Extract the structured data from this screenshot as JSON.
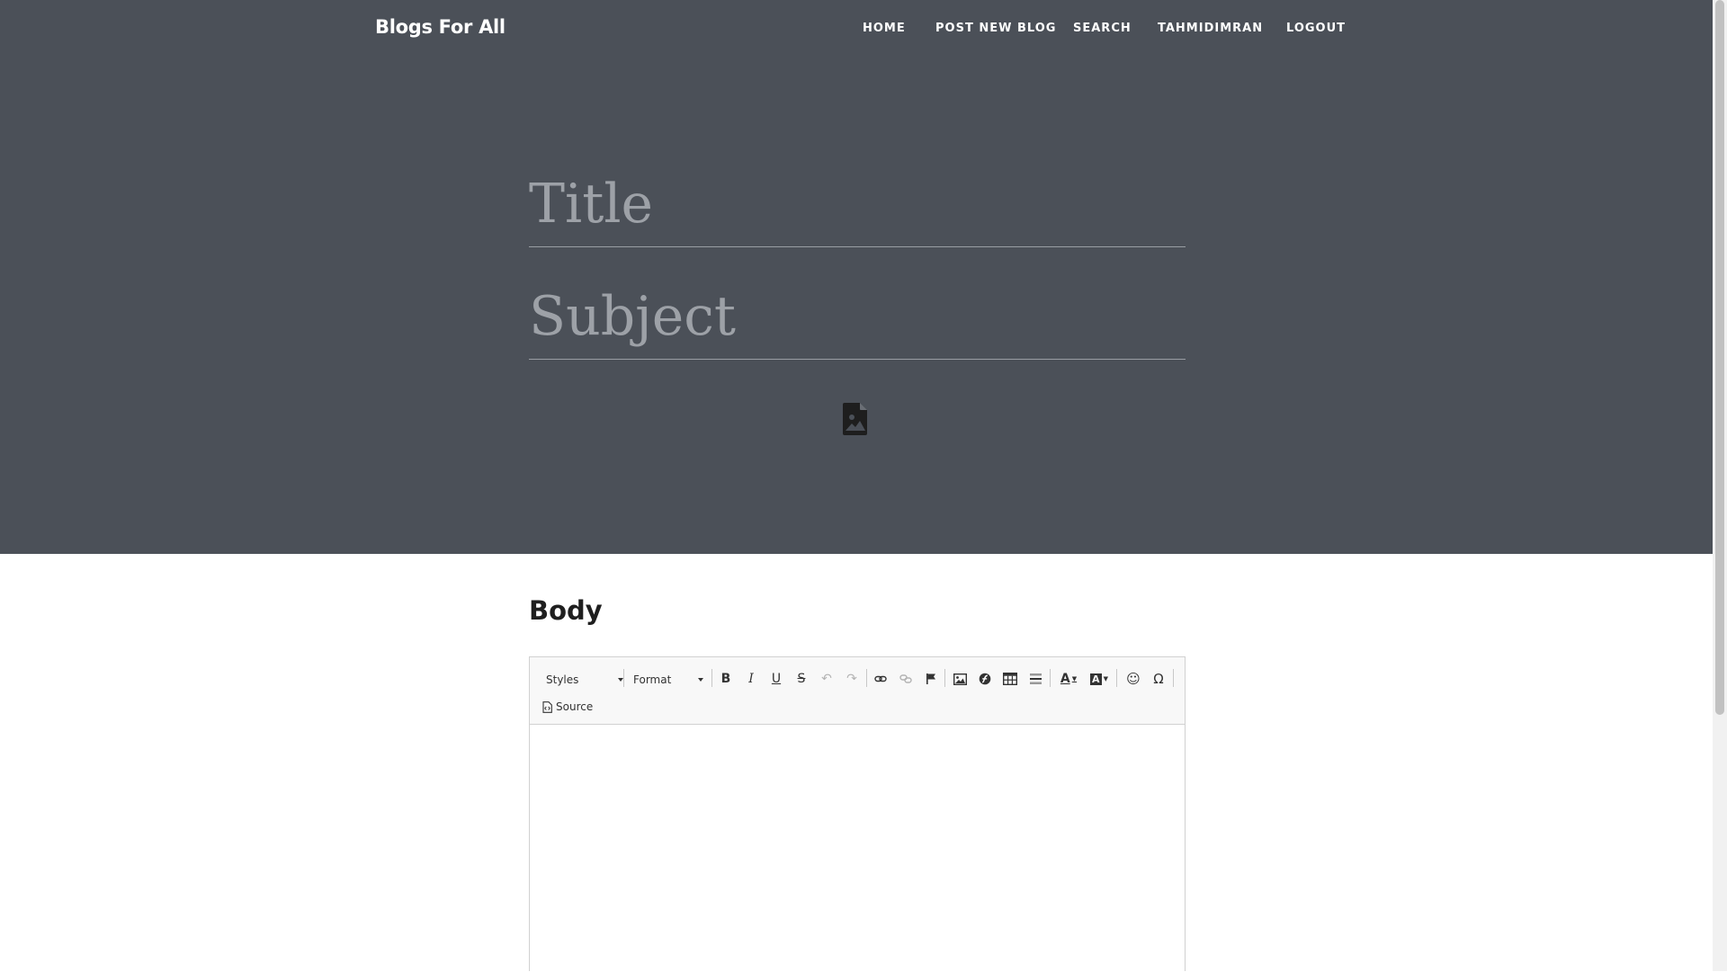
{
  "header": {
    "brand": "Blogs For All",
    "nav": [
      {
        "label": "HOME"
      },
      {
        "label": "POST NEW BLOG"
      },
      {
        "label": "SEARCH"
      },
      {
        "label": "TAHMIDIMRAN"
      },
      {
        "label": "LOGOUT"
      }
    ]
  },
  "form": {
    "title_placeholder": "Title",
    "title_value": "",
    "subject_placeholder": "Subject",
    "subject_value": "",
    "upload_icon": "image-file-icon"
  },
  "body_section": {
    "heading": "Body"
  },
  "editor": {
    "styles_label": "Styles",
    "format_label": "Format",
    "buttons": [
      {
        "name": "bold",
        "glyph": "B"
      },
      {
        "name": "italic",
        "glyph": "I"
      },
      {
        "name": "underline",
        "glyph": "U"
      },
      {
        "name": "strikethrough",
        "glyph": "S"
      },
      {
        "name": "undo",
        "glyph": "↶"
      },
      {
        "name": "redo",
        "glyph": "↷"
      },
      {
        "name": "link",
        "glyph": "link"
      },
      {
        "name": "unlink",
        "glyph": "unlink"
      },
      {
        "name": "anchor",
        "glyph": "flag"
      },
      {
        "name": "image",
        "glyph": "image"
      },
      {
        "name": "flash",
        "glyph": "flash"
      },
      {
        "name": "table",
        "glyph": "table"
      },
      {
        "name": "horizontal-line",
        "glyph": "hr"
      },
      {
        "name": "text-color",
        "glyph": "A"
      },
      {
        "name": "background-color",
        "glyph": "A"
      },
      {
        "name": "smiley",
        "glyph": "☺"
      },
      {
        "name": "special-char",
        "glyph": "Ω"
      }
    ],
    "source_label": "Source",
    "content": ""
  },
  "colors": {
    "hero_bg": "#4b5058",
    "toolbar_bg": "#f8f8f8"
  }
}
